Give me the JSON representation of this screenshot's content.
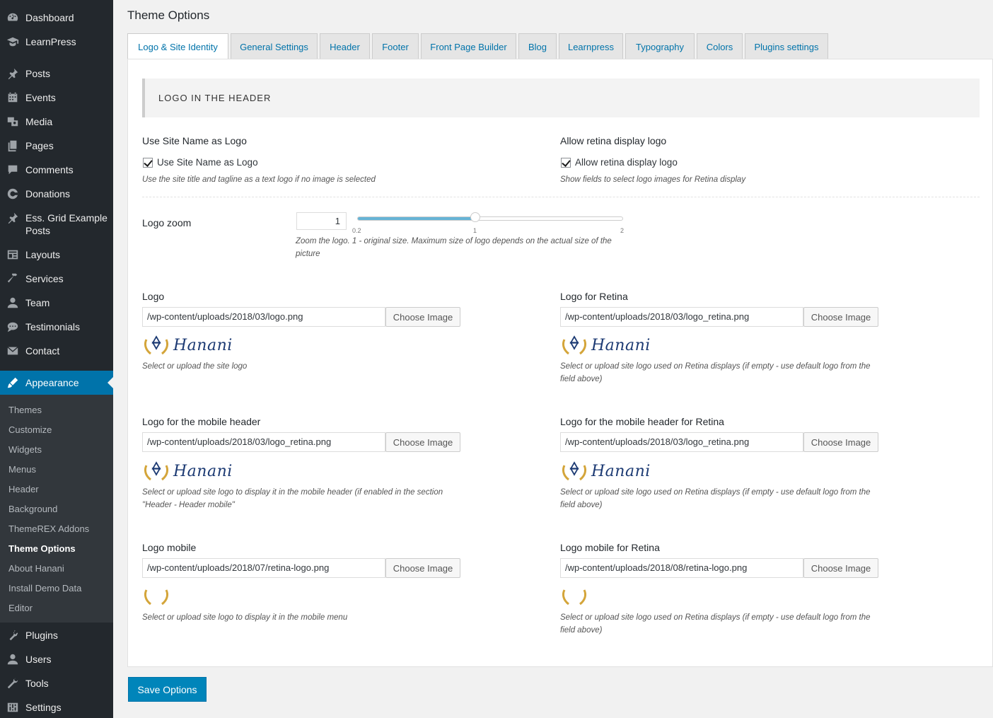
{
  "sidebar": {
    "items": [
      {
        "label": "Dashboard",
        "icon": "dashboard-icon"
      },
      {
        "label": "LearnPress",
        "icon": "learnpress-icon"
      },
      {
        "label": "Posts",
        "icon": "pin-icon"
      },
      {
        "label": "Events",
        "icon": "calendar-icon"
      },
      {
        "label": "Media",
        "icon": "media-icon"
      },
      {
        "label": "Pages",
        "icon": "pages-icon"
      },
      {
        "label": "Comments",
        "icon": "comments-icon"
      },
      {
        "label": "Donations",
        "icon": "donations-icon"
      },
      {
        "label": "Ess. Grid Example Posts",
        "icon": "pin-icon"
      },
      {
        "label": "Layouts",
        "icon": "layouts-icon"
      },
      {
        "label": "Services",
        "icon": "hammer-icon"
      },
      {
        "label": "Team",
        "icon": "user-icon"
      },
      {
        "label": "Testimonials",
        "icon": "chat-icon"
      },
      {
        "label": "Contact",
        "icon": "mail-icon"
      },
      {
        "label": "Appearance",
        "icon": "brush-icon"
      },
      {
        "label": "Plugins",
        "icon": "plugin-icon"
      },
      {
        "label": "Users",
        "icon": "users-icon"
      },
      {
        "label": "Tools",
        "icon": "wrench-icon"
      },
      {
        "label": "Settings",
        "icon": "settings-icon"
      }
    ],
    "submenu": [
      "Themes",
      "Customize",
      "Widgets",
      "Menus",
      "Header",
      "Background",
      "ThemeREX Addons",
      "Theme Options",
      "About Hanani",
      "Install Demo Data",
      "Editor"
    ]
  },
  "page": {
    "title": "Theme Options",
    "tabs": [
      "Logo & Site Identity",
      "General Settings",
      "Header",
      "Footer",
      "Front Page Builder",
      "Blog",
      "Learnpress",
      "Typography",
      "Colors",
      "Plugins settings"
    ],
    "active_tab": "Logo & Site Identity"
  },
  "section": {
    "heading": "LOGO IN THE HEADER"
  },
  "fields": {
    "use_site_name": {
      "title": "Use Site Name as Logo",
      "checkbox_label": "Use Site Name as Logo",
      "checked": true,
      "desc": "Use the site title and tagline as a text logo if no image is selected"
    },
    "retina": {
      "title": "Allow retina display logo",
      "checkbox_label": "Allow retina display logo",
      "checked": true,
      "desc": "Show fields to select logo images for Retina display"
    },
    "zoom": {
      "title": "Logo zoom",
      "value": "1",
      "min_label": "0.2",
      "mid_label": "1",
      "max_label": "2",
      "level": 1,
      "desc": "Zoom the logo. 1 - original size. Maximum size of logo depends on the actual size of the picture"
    },
    "logo": {
      "title": "Logo",
      "value": "/wp-content/uploads/2018/03/logo.png",
      "button": "Choose Image",
      "logo_text": "Hanani",
      "desc": "Select or upload the site logo"
    },
    "logo_retina": {
      "title": "Logo for Retina",
      "value": "/wp-content/uploads/2018/03/logo_retina.png",
      "button": "Choose Image",
      "logo_text": "Hanani",
      "desc": "Select or upload site logo used on Retina displays (if empty - use default logo from the field above)"
    },
    "logo_mobile_header": {
      "title": "Logo for the mobile header",
      "value": "/wp-content/uploads/2018/03/logo_retina.png",
      "button": "Choose Image",
      "logo_text": "Hanani",
      "desc": "Select or upload site logo to display it in the mobile header (if enabled in the section \"Header - Header mobile\""
    },
    "logo_mobile_header_retina": {
      "title": "Logo for the mobile header for Retina",
      "value": "/wp-content/uploads/2018/03/logo_retina.png",
      "button": "Choose Image",
      "logo_text": "Hanani",
      "desc": "Select or upload site logo used on Retina displays (if empty - use default logo from the field above)"
    },
    "logo_mobile": {
      "title": "Logo mobile",
      "value": "/wp-content/uploads/2018/07/retina-logo.png",
      "button": "Choose Image",
      "desc": "Select or upload site logo to display it in the mobile menu"
    },
    "logo_mobile_retina": {
      "title": "Logo mobile for Retina",
      "value": "/wp-content/uploads/2018/08/retina-logo.png",
      "button": "Choose Image",
      "desc": "Select or upload site logo used on Retina displays (if empty - use default logo from the field above)"
    }
  },
  "save_button": "Save Options",
  "colors": {
    "sidebar_bg": "#23282d",
    "submenu_bg": "#32373c",
    "accent": "#0073aa",
    "save_button": "#0085ba",
    "logo_gold": "#d4a53a",
    "logo_navy": "#1c3a73"
  }
}
